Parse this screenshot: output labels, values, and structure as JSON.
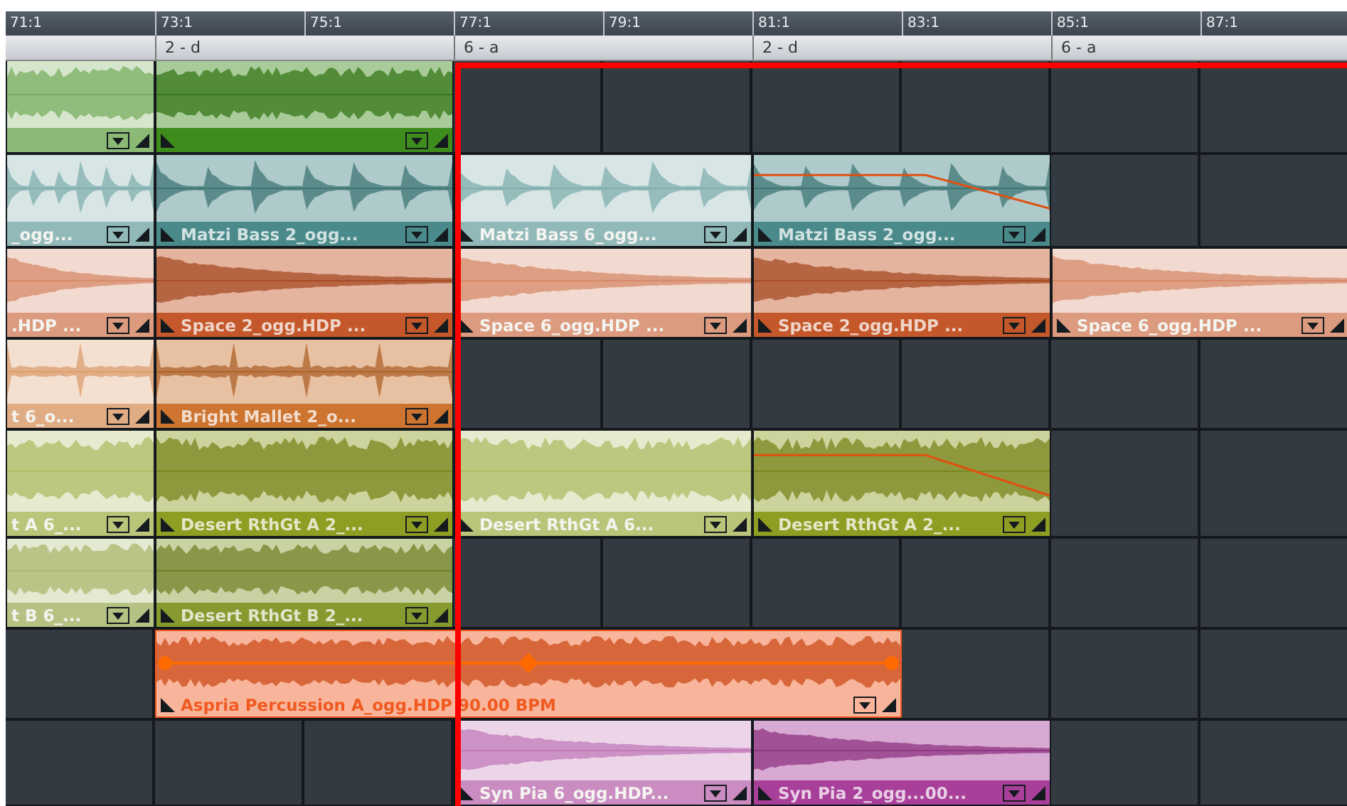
{
  "ruler": {
    "ticks": [
      "71:1",
      "73:1",
      "75:1",
      "77:1",
      "79:1",
      "81:1",
      "83:1",
      "85:1",
      "87:1"
    ]
  },
  "markers": [
    "2 - d",
    "6 - a",
    "2 - d",
    "6 - a"
  ],
  "tracks": [
    {
      "color": "#3e8c1c",
      "kind": "noise",
      "clips": [
        {
          "kind": "cut",
          "selected": false,
          "automation": false
        },
        {
          "kind": "clip",
          "selected": true,
          "automation": false
        }
      ]
    },
    {
      "color": "#4a8a8a",
      "kind": "pulses",
      "clips": [
        {
          "kind": "cut",
          "selected": false,
          "automation": false,
          "label": "_ogg..."
        },
        {
          "kind": "clip",
          "selected": true,
          "automation": false,
          "label": "Matzi Bass 2_ogg..."
        },
        {
          "kind": "clip",
          "selected": false,
          "automation": false,
          "label": "Matzi Bass 6_ogg..."
        },
        {
          "kind": "clip",
          "selected": true,
          "automation": true,
          "label": "Matzi Bass 2_ogg..."
        }
      ]
    },
    {
      "color": "#c4582a",
      "kind": "swell",
      "clips": [
        {
          "kind": "cut",
          "selected": false,
          "automation": false,
          "label": ".HDP  ..."
        },
        {
          "kind": "clip",
          "selected": true,
          "automation": false,
          "label": "Space 2_ogg.HDP  ..."
        },
        {
          "kind": "clip",
          "selected": false,
          "automation": false,
          "label": "Space 6_ogg.HDP  ..."
        },
        {
          "kind": "clip",
          "selected": true,
          "automation": false,
          "label": "Space 2_ogg.HDP  ..."
        },
        {
          "kind": "clip",
          "selected": false,
          "automation": false,
          "label": "Space 6_ogg.HDP  ..."
        }
      ]
    },
    {
      "color": "#cc7430",
      "kind": "hits",
      "clips": [
        {
          "kind": "cut",
          "selected": false,
          "automation": false,
          "label": "t 6_o..."
        },
        {
          "kind": "clip",
          "selected": true,
          "automation": false,
          "label": "Bright Mallet 2_o..."
        }
      ]
    },
    {
      "color": "#8e9e22",
      "kind": "noise",
      "clips": [
        {
          "kind": "cut",
          "selected": false,
          "automation": false,
          "label": "t A 6_..."
        },
        {
          "kind": "clip",
          "selected": true,
          "automation": false,
          "label": "Desert RthGt A 2_..."
        },
        {
          "kind": "clip",
          "selected": false,
          "automation": false,
          "label": "Desert RthGt A 6..."
        },
        {
          "kind": "clip",
          "selected": true,
          "automation": true,
          "label": "Desert RthGt A 2_..."
        }
      ]
    },
    {
      "color": "#869a30",
      "kind": "noise",
      "clips": [
        {
          "kind": "cut",
          "selected": false,
          "automation": false,
          "label": "t B 6_..."
        },
        {
          "kind": "clip",
          "selected": true,
          "automation": false,
          "label": "Desert RthGt B 2_..."
        }
      ]
    },
    {
      "color": "#f05a20",
      "kind": "noise",
      "clips": [
        {
          "kind": "gap"
        },
        {
          "kind": "long",
          "selected": true,
          "automation": true,
          "label": "Aspria Percussion A_ogg.HDP  90.00 BPM"
        }
      ]
    },
    {
      "color": "#a8409a",
      "kind": "swell",
      "clips": [
        {
          "kind": "gap"
        },
        {
          "kind": "gap"
        },
        {
          "kind": "gap"
        },
        {
          "kind": "clip",
          "selected": false,
          "automation": false,
          "label": "Syn Pia 6_ogg.HDP..."
        },
        {
          "kind": "clip",
          "selected": true,
          "automation": false,
          "label": "Syn Pia 2_ogg...00..."
        }
      ]
    }
  ]
}
